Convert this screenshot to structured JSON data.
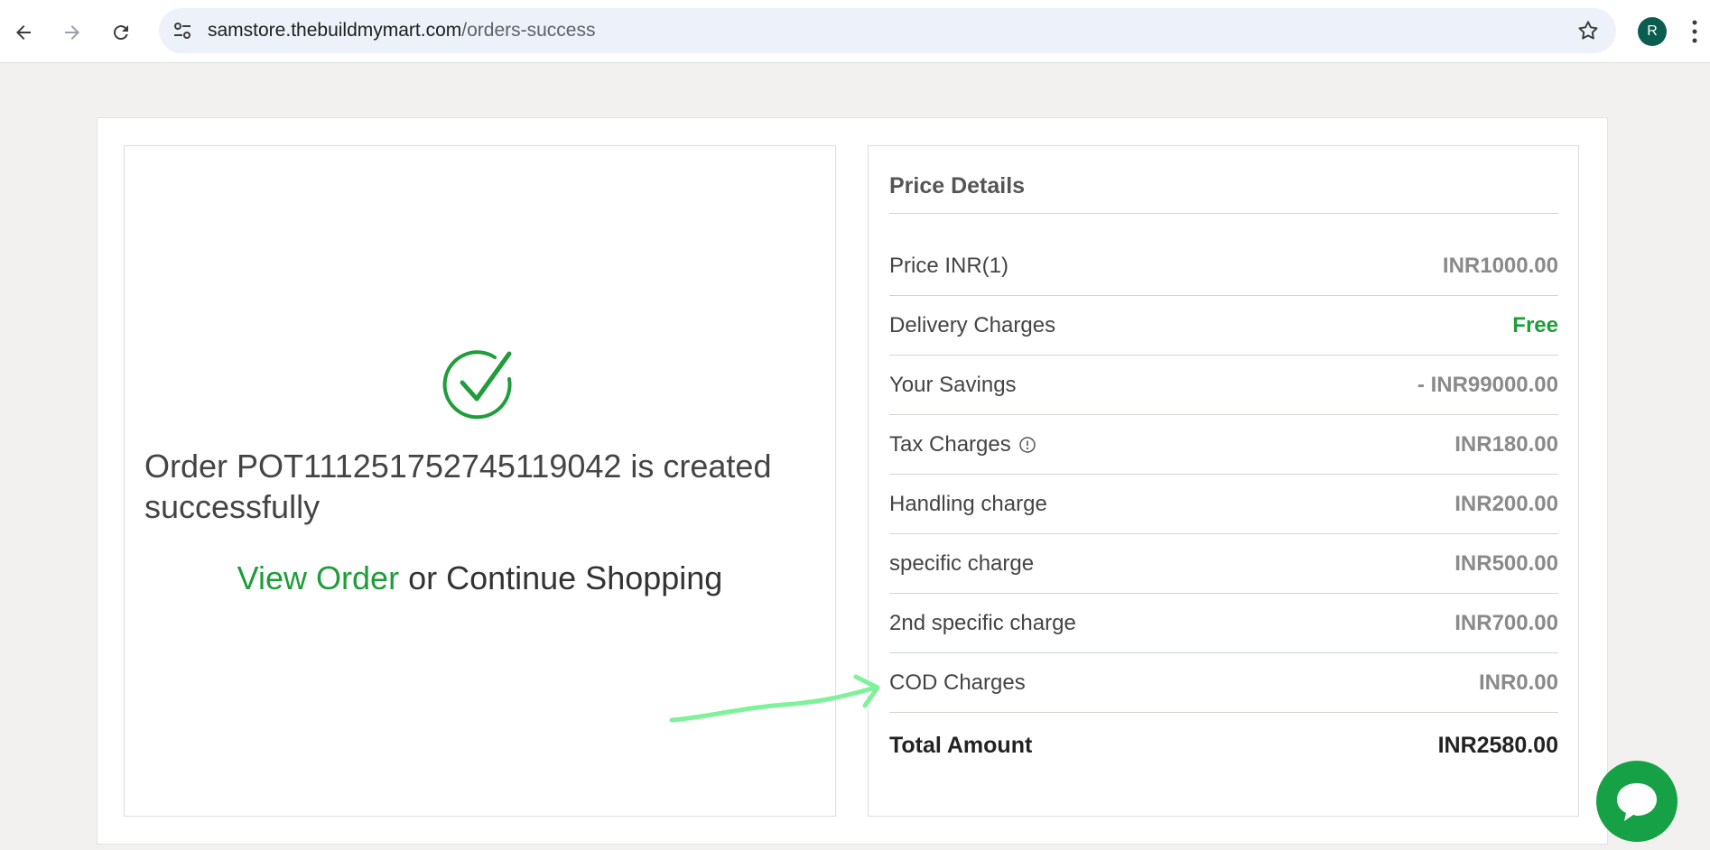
{
  "browser": {
    "url_host": "samstore.thebuildmymart.com",
    "url_path": "/orders-success",
    "avatar_letter": "R"
  },
  "order": {
    "message": "Order POT111251752745119042 is created successfully",
    "view_order_label": "View Order",
    "or_text": " or ",
    "continue_label": "Continue Shopping"
  },
  "price_details": {
    "title": "Price Details",
    "rows": [
      {
        "label": "Price INR(1)",
        "value": "INR1000.00"
      },
      {
        "label": "Delivery Charges",
        "value": "Free"
      },
      {
        "label": "Your Savings",
        "value": "- INR99000.00"
      },
      {
        "label": "Tax Charges",
        "value": "INR180.00"
      },
      {
        "label": "Handling charge",
        "value": "INR200.00"
      },
      {
        "label": "specific charge",
        "value": "INR500.00"
      },
      {
        "label": "2nd specific charge",
        "value": "INR700.00"
      },
      {
        "label": "COD Charges",
        "value": "INR0.00"
      }
    ],
    "total_label": "Total Amount",
    "total_value": "INR2580.00"
  },
  "colors": {
    "accent_green": "#1f9d3a",
    "chat_green": "#17a146",
    "annotation_green": "#7ef29a"
  },
  "icons": [
    "back-arrow-icon",
    "forward-arrow-icon",
    "reload-icon",
    "site-settings-icon",
    "star-icon",
    "kebab-menu-icon",
    "success-check-icon",
    "info-icon",
    "chat-icon"
  ]
}
